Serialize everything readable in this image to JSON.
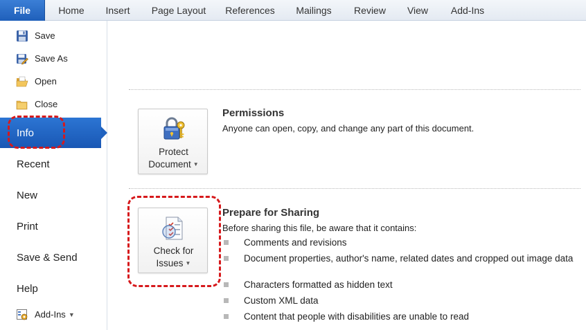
{
  "ribbon": {
    "file_tab": "File",
    "tabs": [
      "Home",
      "Insert",
      "Page Layout",
      "References",
      "Mailings",
      "Review",
      "View",
      "Add-Ins"
    ]
  },
  "backstage": {
    "commands": {
      "save": "Save",
      "save_as": "Save As",
      "open": "Open",
      "close": "Close"
    },
    "nav": {
      "info": "Info",
      "recent": "Recent",
      "new": "New",
      "print": "Print",
      "save_send": "Save & Send",
      "help": "Help",
      "addins": "Add-Ins"
    },
    "icons": [
      "floppy-disk-icon",
      "save-as-icon",
      "open-folder-icon",
      "close-folder-icon",
      "addins-icon",
      "padlock-key-icon",
      "checklist-icon"
    ],
    "highlight_color": "#d6191c",
    "accent_color": "#1f62bf"
  },
  "info": {
    "permissions": {
      "button_line1": "Protect",
      "button_line2": "Document",
      "title": "Permissions",
      "description": "Anyone can open, copy, and change any part of this document."
    },
    "prepare": {
      "button_line1": "Check for",
      "button_line2": "Issues",
      "title": "Prepare for Sharing",
      "description": "Before sharing this file, be aware that it contains:",
      "items": [
        "Comments and revisions",
        "Document properties, author's name, related dates and cropped out image data",
        "Characters formatted as hidden text",
        "Custom XML data",
        "Content that people with disabilities are unable to read"
      ]
    }
  }
}
